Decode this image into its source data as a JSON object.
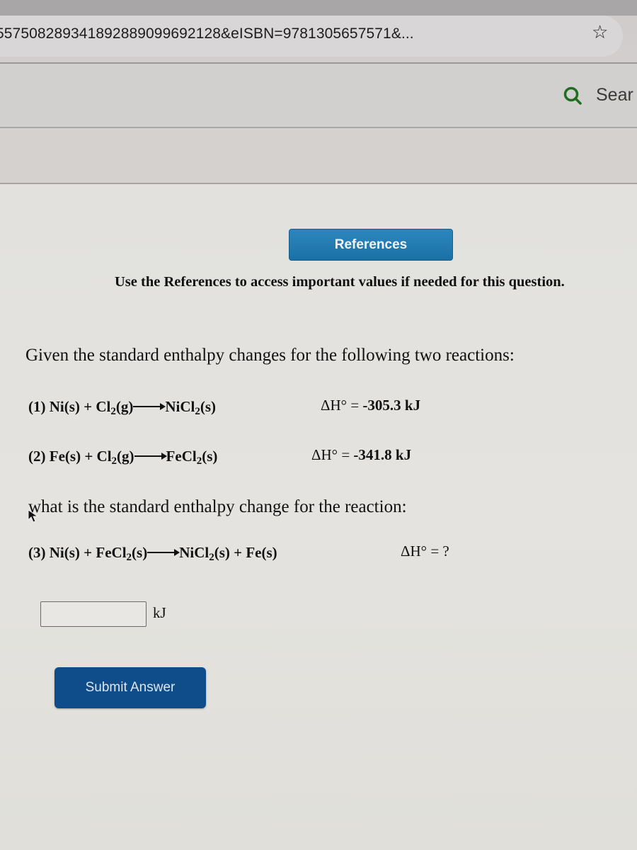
{
  "browser": {
    "url_text": "557508289341892889099692128&eISBN=9781305657571&...",
    "bookmark_icon": "star-outline-icon",
    "search_icon": "search-icon",
    "search_label": "Sear",
    "accent_color": "#1f6d1f"
  },
  "references": {
    "button_label": "References",
    "note": "Use the References to access important values if needed for this question.",
    "button_color": "#1a71a6"
  },
  "question": {
    "intro": "Given the standard enthalpy changes for the following two reactions:",
    "reactions": [
      {
        "number": "(1)",
        "reactants": [
          {
            "formula": "Ni",
            "sub": "",
            "state": "(s)"
          },
          {
            "formula": "Cl",
            "sub": "2",
            "state": "(g)"
          }
        ],
        "products": [
          {
            "formula": "NiCl",
            "sub": "2",
            "state": "(s)"
          }
        ],
        "delta_h_label": "ΔH° =",
        "delta_h_value": "-305.3",
        "unit": "kJ"
      },
      {
        "number": "(2)",
        "reactants": [
          {
            "formula": "Fe",
            "sub": "",
            "state": "(s)"
          },
          {
            "formula": "Cl",
            "sub": "2",
            "state": "(g)"
          }
        ],
        "products": [
          {
            "formula": "FeCl",
            "sub": "2",
            "state": "(s)"
          }
        ],
        "delta_h_label": "ΔH° =",
        "delta_h_value": "-341.8",
        "unit": "kJ"
      }
    ],
    "prompt": "what is the standard enthalpy change for the reaction:",
    "target_reaction": {
      "number": "(3)",
      "reactants": [
        {
          "formula": "Ni",
          "sub": "",
          "state": "(s)"
        },
        {
          "formula": "FeCl",
          "sub": "2",
          "state": "(s)"
        }
      ],
      "products": [
        {
          "formula": "NiCl",
          "sub": "2",
          "state": "(s)"
        },
        {
          "formula": "Fe",
          "sub": "",
          "state": "(s)"
        }
      ],
      "delta_h_label": "ΔH° =",
      "delta_h_value": "?"
    },
    "plus": "+"
  },
  "answer": {
    "value": "",
    "placeholder": "",
    "unit": "kJ",
    "submit_label": "Submit Answer",
    "submit_color": "#0f4d8a"
  }
}
